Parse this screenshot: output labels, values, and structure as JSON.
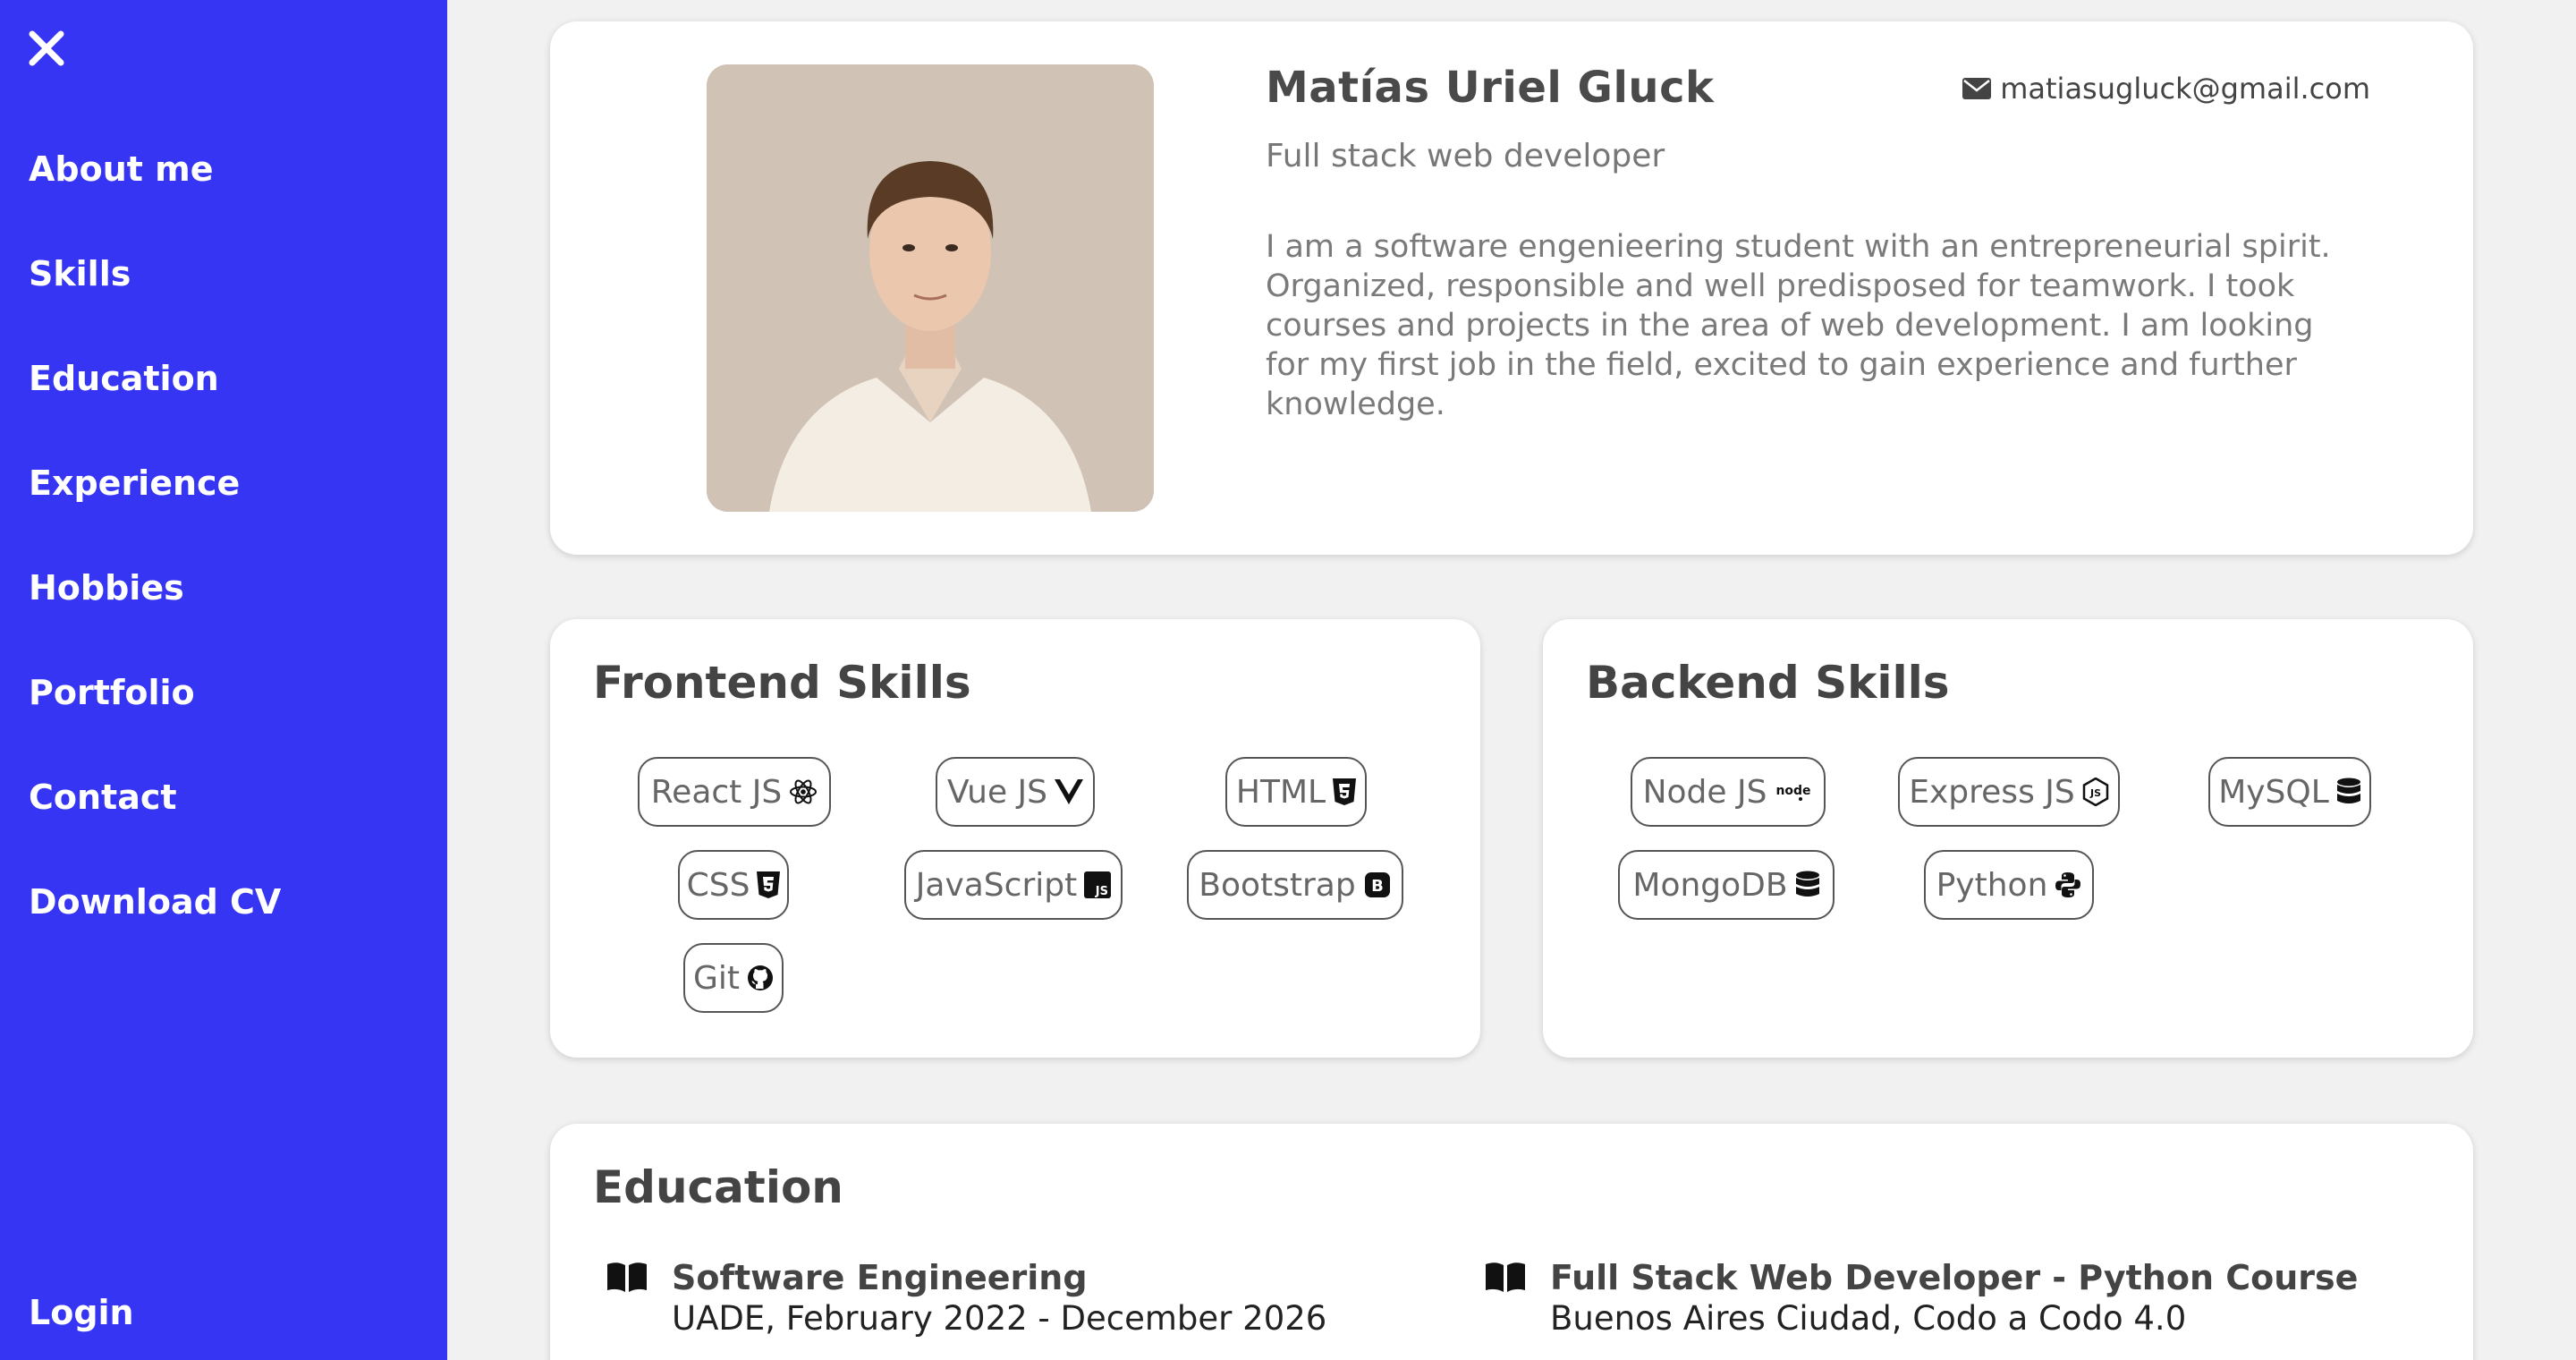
{
  "sidebar": {
    "close_icon": "close-icon",
    "items": [
      {
        "label": "About me"
      },
      {
        "label": "Skills"
      },
      {
        "label": "Education"
      },
      {
        "label": "Experience"
      },
      {
        "label": "Hobbies"
      },
      {
        "label": "Portfolio"
      },
      {
        "label": "Contact"
      },
      {
        "label": "Download CV"
      }
    ],
    "login": "Login",
    "background": "#3535f3"
  },
  "profile": {
    "name": "Matías Uriel Gluck",
    "email": "matiasugluck@gmail.com",
    "role": "Full stack web developer",
    "about": "I am a software engenieering student with an entrepreneurial spirit. Organized, responsible and well predisposed for teamwork. I took courses and projects in the area of web development. I am looking for my first job in the field, excited to gain experience and further knowledge.",
    "photo_icon": "profile-photo"
  },
  "frontend": {
    "title": "Frontend Skills",
    "skills": [
      {
        "label": "React JS",
        "icon": "react-icon"
      },
      {
        "label": "Vue JS",
        "icon": "vue-icon"
      },
      {
        "label": "HTML",
        "icon": "html5-icon"
      },
      {
        "label": "CSS",
        "icon": "css3-icon"
      },
      {
        "label": "JavaScript",
        "icon": "js-icon"
      },
      {
        "label": "Bootstrap",
        "icon": "bootstrap-icon"
      },
      {
        "label": "Git",
        "icon": "github-icon"
      }
    ]
  },
  "backend": {
    "title": "Backend Skills",
    "skills": [
      {
        "label": "Node JS",
        "icon": "node-icon"
      },
      {
        "label": "Express JS",
        "icon": "express-icon"
      },
      {
        "label": "MySQL",
        "icon": "database-icon"
      },
      {
        "label": "MongoDB",
        "icon": "database-icon"
      },
      {
        "label": "Python",
        "icon": "python-icon"
      }
    ]
  },
  "education": {
    "title": "Education",
    "items": [
      {
        "degree": "Software Engineering",
        "detail": "UADE, February 2022 - December 2026"
      },
      {
        "degree": "Full Stack Web Developer - Python Course",
        "detail": "Buenos Aires Ciudad, Codo a Codo 4.0"
      }
    ]
  }
}
